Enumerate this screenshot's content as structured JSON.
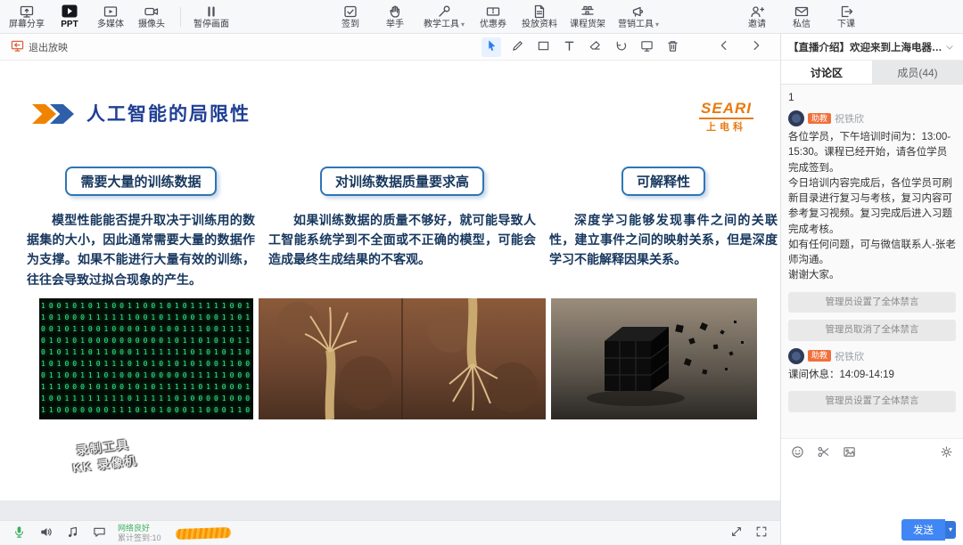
{
  "colors": {
    "accent_orange": "#f08300",
    "title_navy": "#1f3f94",
    "body_navy": "#17375e",
    "box_border_blue": "#2e75b6",
    "logo_orange": "#e87a10",
    "send_button_blue": "#4086f4",
    "badge_orange": "#f0703c",
    "network_green": "#3db05d",
    "tool_active_blue": "#2b7cf0"
  },
  "top_toolbar": {
    "left": [
      {
        "label": "屏幕分享",
        "icon": "screen-share-icon",
        "active": false
      },
      {
        "label": "PPT",
        "icon": "ppt-icon",
        "active": true
      },
      {
        "label": "多媒体",
        "icon": "multimedia-icon",
        "active": false
      },
      {
        "label": "摄像头",
        "icon": "camera-icon",
        "active": false
      },
      {
        "label": "暂停画面",
        "icon": "pause-screen-icon",
        "active": false
      }
    ],
    "center": [
      {
        "label": "签到",
        "icon": "checkin-icon"
      },
      {
        "label": "举手",
        "icon": "raise-hand-icon"
      },
      {
        "label": "教学工具",
        "icon": "teaching-tools-icon",
        "dropdown": true
      },
      {
        "label": "优惠券",
        "icon": "coupon-icon"
      },
      {
        "label": "投放资料",
        "icon": "materials-icon"
      },
      {
        "label": "课程货架",
        "icon": "course-shelf-icon"
      },
      {
        "label": "营销工具",
        "icon": "marketing-tools-icon",
        "dropdown": true
      }
    ],
    "right": [
      {
        "label": "邀请",
        "icon": "invite-icon"
      },
      {
        "label": "私信",
        "icon": "private-message-icon"
      },
      {
        "label": "下课",
        "icon": "end-class-icon"
      }
    ]
  },
  "canvas_toolbar": {
    "exit_label": "退出放映",
    "tools": [
      {
        "icon": "cursor-icon",
        "selected": true
      },
      {
        "icon": "pen-icon"
      },
      {
        "icon": "rectangle-icon"
      },
      {
        "icon": "text-icon"
      },
      {
        "icon": "eraser-icon"
      },
      {
        "icon": "undo-icon"
      },
      {
        "icon": "screen-annotate-icon"
      },
      {
        "icon": "trash-icon"
      }
    ],
    "nav": [
      {
        "icon": "prev-slide-icon"
      },
      {
        "icon": "next-slide-icon"
      }
    ]
  },
  "slide": {
    "title": "人工智能的局限性",
    "logo": {
      "brand": "SEARI",
      "sub": "上电科"
    },
    "columns": [
      {
        "heading": "需要大量的训练数据",
        "body": "模型性能能否提升取决于训练用的数据集的大小，因此通常需要大量的数据作为支撑。如果不能进行大量有效的训练，往往会导致过拟合现象的产生。"
      },
      {
        "heading": "对训练数据质量要求高",
        "body": "如果训练数据的质量不够好，就可能导致人工智能系统学到不全面或不正确的模型，可能会造成最终生成结果的不客观。"
      },
      {
        "heading": "可解释性",
        "body": "深度学习能够发现事件之间的关联性，建立事件之间的映射关系，但是深度学习不能解释因果关系。"
      }
    ],
    "images": [
      {
        "name": "matrix-code-image"
      },
      {
        "name": "rope-breaking-image"
      },
      {
        "name": "cube-disintegrating-image"
      }
    ],
    "watermark": "录制工具\nKK 录像机"
  },
  "sidebar": {
    "header": "【直播介绍】欢迎来到上海电器…",
    "tabs": [
      {
        "label": "讨论区",
        "active": true
      },
      {
        "label": "成员(44)",
        "active": false
      }
    ],
    "messages": [
      {
        "type": "text",
        "text": "1"
      },
      {
        "type": "user",
        "name": "祝铁欣",
        "badge": "助教",
        "text": "各位学员，下午培训时间为：13:00-15:30。课程已经开始，请各位学员完成签到。\n今日培训内容完成后，各位学员可刷新目录进行复习与考核，复习内容可参考复习视频。复习完成后进入习题完成考核。\n如有任何问题，可与微信联系人-张老师沟通。\n谢谢大家。"
      },
      {
        "type": "system",
        "text": "管理员设置了全体禁言"
      },
      {
        "type": "system",
        "text": "管理员取消了全体禁言"
      },
      {
        "type": "user",
        "name": "祝铁欣",
        "badge": "助教",
        "text": "课间休息：14:09-14:19"
      },
      {
        "type": "system",
        "text": "管理员设置了全体禁言"
      }
    ],
    "input_value": "",
    "send_label": "发送"
  },
  "bottom_bar": {
    "network_status": "网络良好",
    "checkin_total": "累计签到:10"
  }
}
